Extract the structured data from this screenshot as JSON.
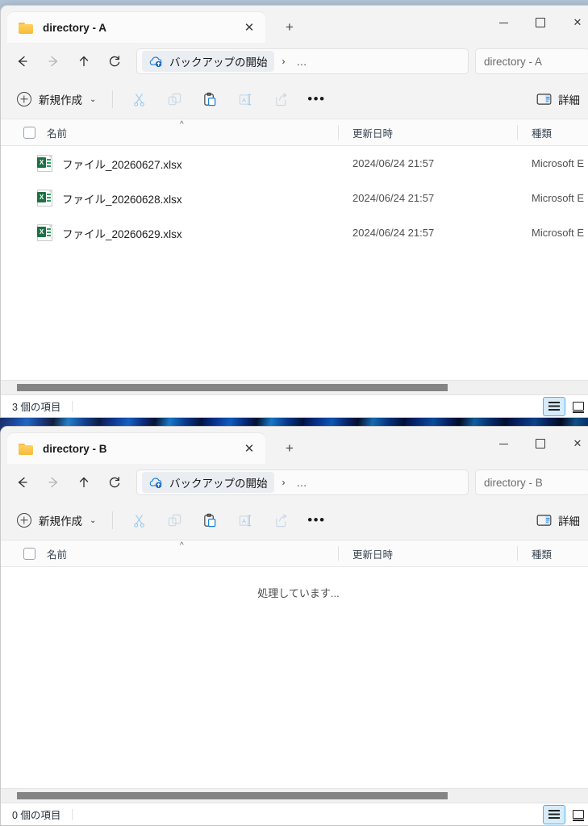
{
  "desktop": {
    "wallpaper_color": "#0b3fa8"
  },
  "windows": [
    {
      "id": "a",
      "tab": {
        "title": "directory - A",
        "folder_icon": "folder-icon",
        "close_icon": "close-icon"
      },
      "new_tab_label": "+",
      "window_controls": {
        "minimize": "minimize-icon",
        "maximize": "maximize-icon",
        "close": "close-icon"
      },
      "nav": {
        "back": "arrow-left-icon",
        "forward": "arrow-right-icon",
        "up": "arrow-up-icon",
        "refresh": "refresh-icon"
      },
      "address": {
        "crumb_icon": "onedrive-cloud-icon",
        "crumb_label": "バックアップの開始",
        "separator": "›",
        "more": "…"
      },
      "search": {
        "placeholder": "directory - A"
      },
      "toolbar": {
        "new_label": "新規作成",
        "new_chevron": "⌄",
        "cut": "scissors-icon",
        "copy": "copy-icon",
        "paste": "paste-icon",
        "rename": "rename-icon",
        "share": "share-icon",
        "more": "•••",
        "details_label": "詳細"
      },
      "columns": [
        "名前",
        "更新日時",
        "種類"
      ],
      "sort_indicator": "^",
      "files": [
        {
          "name": "ファイル_20260627.xlsx",
          "modified": "2024/06/24 21:57",
          "type": "Microsoft E",
          "icon": "excel-file-icon"
        },
        {
          "name": "ファイル_20260628.xlsx",
          "modified": "2024/06/24 21:57",
          "type": "Microsoft E",
          "icon": "excel-file-icon"
        },
        {
          "name": "ファイル_20260629.xlsx",
          "modified": "2024/06/24 21:57",
          "type": "Microsoft E",
          "icon": "excel-file-icon"
        }
      ],
      "empty_message": "",
      "status": {
        "count_label": "3 個の項目"
      },
      "view_modes": {
        "details": "details-view-icon",
        "tiles": "tiles-view-icon",
        "active": "details"
      }
    },
    {
      "id": "b",
      "tab": {
        "title": "directory - B",
        "folder_icon": "folder-icon",
        "close_icon": "close-icon"
      },
      "new_tab_label": "+",
      "window_controls": {
        "minimize": "minimize-icon",
        "maximize": "maximize-icon",
        "close": "close-icon"
      },
      "nav": {
        "back": "arrow-left-icon",
        "forward": "arrow-right-icon",
        "up": "arrow-up-icon",
        "refresh": "refresh-icon"
      },
      "address": {
        "crumb_icon": "onedrive-cloud-icon",
        "crumb_label": "バックアップの開始",
        "separator": "›",
        "more": "…"
      },
      "search": {
        "placeholder": "directory - B"
      },
      "toolbar": {
        "new_label": "新規作成",
        "new_chevron": "⌄",
        "cut": "scissors-icon",
        "copy": "copy-icon",
        "paste": "paste-icon",
        "rename": "rename-icon",
        "share": "share-icon",
        "more": "•••",
        "details_label": "詳細"
      },
      "columns": [
        "名前",
        "更新日時",
        "種類"
      ],
      "sort_indicator": "^",
      "files": [],
      "empty_message": "処理しています...",
      "status": {
        "count_label": "0 個の項目"
      },
      "view_modes": {
        "details": "details-view-icon",
        "tiles": "tiles-view-icon",
        "active": "details"
      }
    }
  ]
}
